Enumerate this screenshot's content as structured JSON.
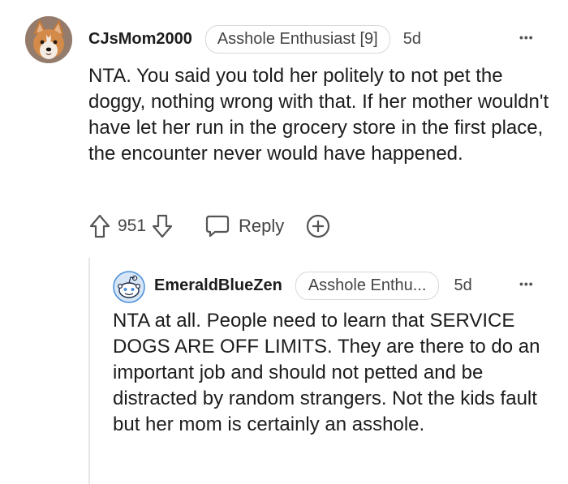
{
  "comment": {
    "username": "CJsMom2000",
    "flair": "Asshole Enthusiast [9]",
    "age": "5d",
    "more_label": "•••",
    "text": "NTA. You said you told her politely to not pet the doggy, nothing wrong with that. If her mother wouldn't have let her run in the grocery store in the first place, the encounter never would have happened.",
    "score": "951",
    "reply_label": "Reply",
    "avatar_icon": "corgi-avatar",
    "icons": [
      "upvote-icon",
      "downvote-icon",
      "reply-icon",
      "award-icon",
      "more-icon"
    ]
  },
  "reply": {
    "username": "EmeraldBlueZen",
    "flair": "Asshole Enthu...",
    "age": "5d",
    "more_label": "•••",
    "text": "NTA at all. People need to learn that SERVICE DOGS ARE OFF LIMITS. They are there to do an important job and should not petted and be distracted by random strangers. Not the kids fault but her mom is certainly an asshole.",
    "avatar_icon": "snoo-avatar"
  },
  "colors": {
    "text": "#1c1c1c",
    "muted": "#555555",
    "flair_border": "#d8d8d8",
    "snoo_blue": "#4a8fd8"
  }
}
